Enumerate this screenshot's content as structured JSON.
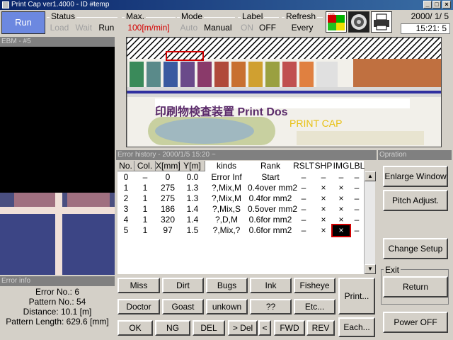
{
  "window": {
    "title": "Print Cap ver1.4000 - ID #temp"
  },
  "toolbar": {
    "run_label": "Run",
    "status": {
      "label": "Status",
      "load": "Load",
      "wait": "Wait",
      "run": "Run"
    },
    "max": {
      "label": "Max.",
      "value": "100[m/min]"
    },
    "mode": {
      "label": "Mode",
      "auto": "Auto",
      "manual": "Manual"
    },
    "label": {
      "label": "Label",
      "on": "ON",
      "off": "OFF"
    },
    "refresh": {
      "label": "Refresh",
      "value": "Every"
    },
    "date": "2000/ 1/ 5",
    "time": "15:21: 5"
  },
  "camera_panel": {
    "title": "EBM - #5"
  },
  "scan_image": {
    "caption_text": "印刷物検査装置  Print Dos",
    "caption_sub": "PRINT CAP"
  },
  "error_info": {
    "title": "Error info",
    "error_no": "Error No.: 6",
    "pattern_no": "Pattern No.: 54",
    "distance": "Distance: 10.1 [m]",
    "pattern_length": "Pattern Length: 629.6 [mm]"
  },
  "history": {
    "title": "Error history - 2000/1/5 15:20 ~",
    "columns": [
      "No.",
      "Col.",
      "X[mm]",
      "Y[m]",
      "kinds",
      "Rank",
      "RSLT",
      "SHP",
      "IMG",
      "LBL"
    ],
    "rows": [
      [
        "0",
        "–",
        "0",
        "0.0",
        "Error Inf",
        "Start",
        "–",
        "–",
        "–",
        "–"
      ],
      [
        "1",
        "1",
        "275",
        "1.3",
        "?,Mix,M",
        "0.4over mm2",
        "–",
        "×",
        "×",
        "–"
      ],
      [
        "2",
        "1",
        "275",
        "1.3",
        "?,Mix,M",
        "0.4for mm2",
        "–",
        "×",
        "×",
        "–"
      ],
      [
        "3",
        "1",
        "186",
        "1.4",
        "?,Mix,S",
        "0.5over mm2",
        "–",
        "×",
        "×",
        "–"
      ],
      [
        "4",
        "1",
        "320",
        "1.4",
        "?,D,M",
        "0.6for mm2",
        "–",
        "×",
        "×",
        "–"
      ],
      [
        "5",
        "1",
        "97",
        "1.5",
        "?,Mix,?",
        "0.6for mm2",
        "–",
        "×",
        "×",
        "–"
      ]
    ]
  },
  "operation": {
    "title": "Opration",
    "enlarge": "Enlarge Window",
    "pitch": "Pitch Adjust.",
    "change_setup": "Change Setup",
    "exit_label": "Exit",
    "return": "Return",
    "power_off": "Power OFF"
  },
  "kind_buttons": {
    "miss": "Miss",
    "dirt": "Dirt",
    "bugs": "Bugs",
    "ink": "Ink",
    "fisheye": "Fisheye",
    "doctor": "Doctor",
    "goast": "Goast",
    "unkown": "unkown",
    "qq": "??",
    "etc": "Etc...",
    "print": "Print...",
    "ok": "OK",
    "ng": "NG",
    "del": "DEL",
    "next_del": "> Del",
    "prev": "<",
    "fwd": "FWD",
    "rev": "REV",
    "each": "Each..."
  }
}
